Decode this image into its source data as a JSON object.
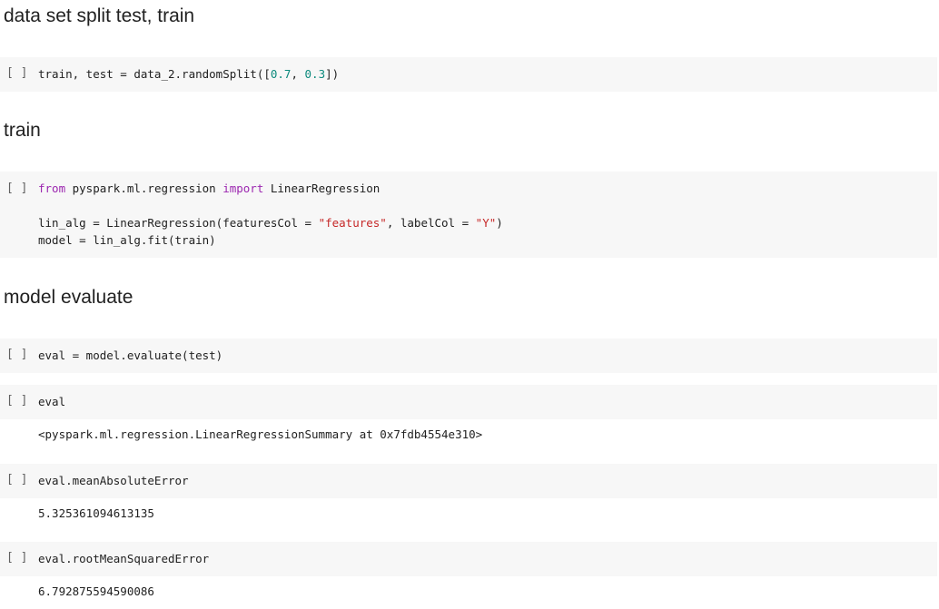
{
  "headings": {
    "split": "data set split test, train",
    "train": "train",
    "evaluate": "model evaluate"
  },
  "cells": {
    "split": {
      "bracket": "[ ]",
      "line1_a": "train, test = data_2.randomSplit([",
      "line1_num1": "0.7",
      "line1_sep": ", ",
      "line1_num2": "0.3",
      "line1_end": "])"
    },
    "train": {
      "bracket": "[ ]",
      "kw_from": "from",
      "module": " pyspark.ml.regression ",
      "kw_import": "import",
      "cls": " LinearRegression",
      "line3_a": "lin_alg = LinearRegression(featuresCol = ",
      "line3_str1": "\"features\"",
      "line3_b": ", labelCol = ",
      "line3_str2": "\"Y\"",
      "line3_end": ")",
      "line4": "model = lin_alg.fit(train)"
    },
    "evaluate": {
      "bracket": "[ ]",
      "code": "eval = model.evaluate(test)"
    },
    "eval_show": {
      "bracket": "[ ]",
      "code": "eval",
      "output": "<pyspark.ml.regression.LinearRegressionSummary at 0x7fdb4554e310>"
    },
    "mae": {
      "bracket": "[ ]",
      "code": "eval.meanAbsoluteError",
      "output": "5.325361094613135"
    },
    "rmse": {
      "bracket": "[ ]",
      "code": "eval.rootMeanSquaredError",
      "output": "6.792875594590086"
    }
  }
}
